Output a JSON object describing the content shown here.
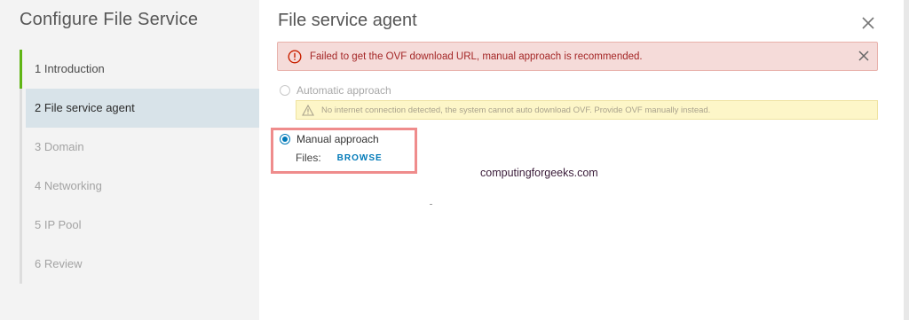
{
  "sidebar": {
    "title": "Configure File Service",
    "steps": [
      {
        "label": "1  Introduction",
        "state": "done"
      },
      {
        "label": "2  File service agent",
        "state": "active"
      },
      {
        "label": "3  Domain",
        "state": "pending"
      },
      {
        "label": "4  Networking",
        "state": "pending"
      },
      {
        "label": "5  IP Pool",
        "state": "pending"
      },
      {
        "label": "6  Review",
        "state": "pending"
      }
    ]
  },
  "main": {
    "title": "File service agent",
    "alert": {
      "message": "Failed to get the OVF download URL, manual approach is recommended.",
      "color": "#a42626"
    },
    "automatic_option": {
      "label": "Automatic approach",
      "selected": false,
      "disabled": true
    },
    "warning": {
      "message": "No internet connection detected, the system cannot auto download OVF. Provide OVF manually instead."
    },
    "manual_option": {
      "label": "Manual approach",
      "selected": true
    },
    "files": {
      "label": "Files:",
      "browse_label": "BROWSE"
    }
  },
  "watermark": "computingforgeeks.com",
  "colors": {
    "accent": "#0079b8",
    "progress_done": "#60b515",
    "active_step_bg": "#d8e3e9",
    "highlight_border": "#ef8c8c"
  }
}
